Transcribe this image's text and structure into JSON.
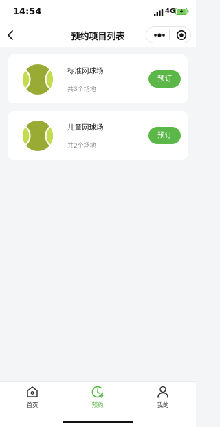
{
  "status_bar": {
    "time": "14:54",
    "network": "4G",
    "icons": [
      "signal-icon",
      "battery-charging-icon"
    ]
  },
  "nav": {
    "title": "预约项目列表",
    "icons": [
      "back-icon",
      "more-icon",
      "close-icon"
    ]
  },
  "venues": [
    {
      "name": "标准网球场",
      "count": "共3个场地",
      "button": "预订",
      "icon": "tennis-ball-icon"
    },
    {
      "name": "儿童网球场",
      "count": "共2个场地",
      "button": "预订",
      "icon": "tennis-ball-icon"
    }
  ],
  "tabs": [
    {
      "label": "首页",
      "icon": "home-icon",
      "active": false
    },
    {
      "label": "预约",
      "icon": "clock-icon",
      "active": true
    },
    {
      "label": "我的",
      "icon": "user-icon",
      "active": false
    }
  ],
  "colors": {
    "accent": "#5bb848",
    "ball_dark": "#9aab35",
    "ball_light": "#c1dc4d",
    "background": "#f4f5f7"
  }
}
